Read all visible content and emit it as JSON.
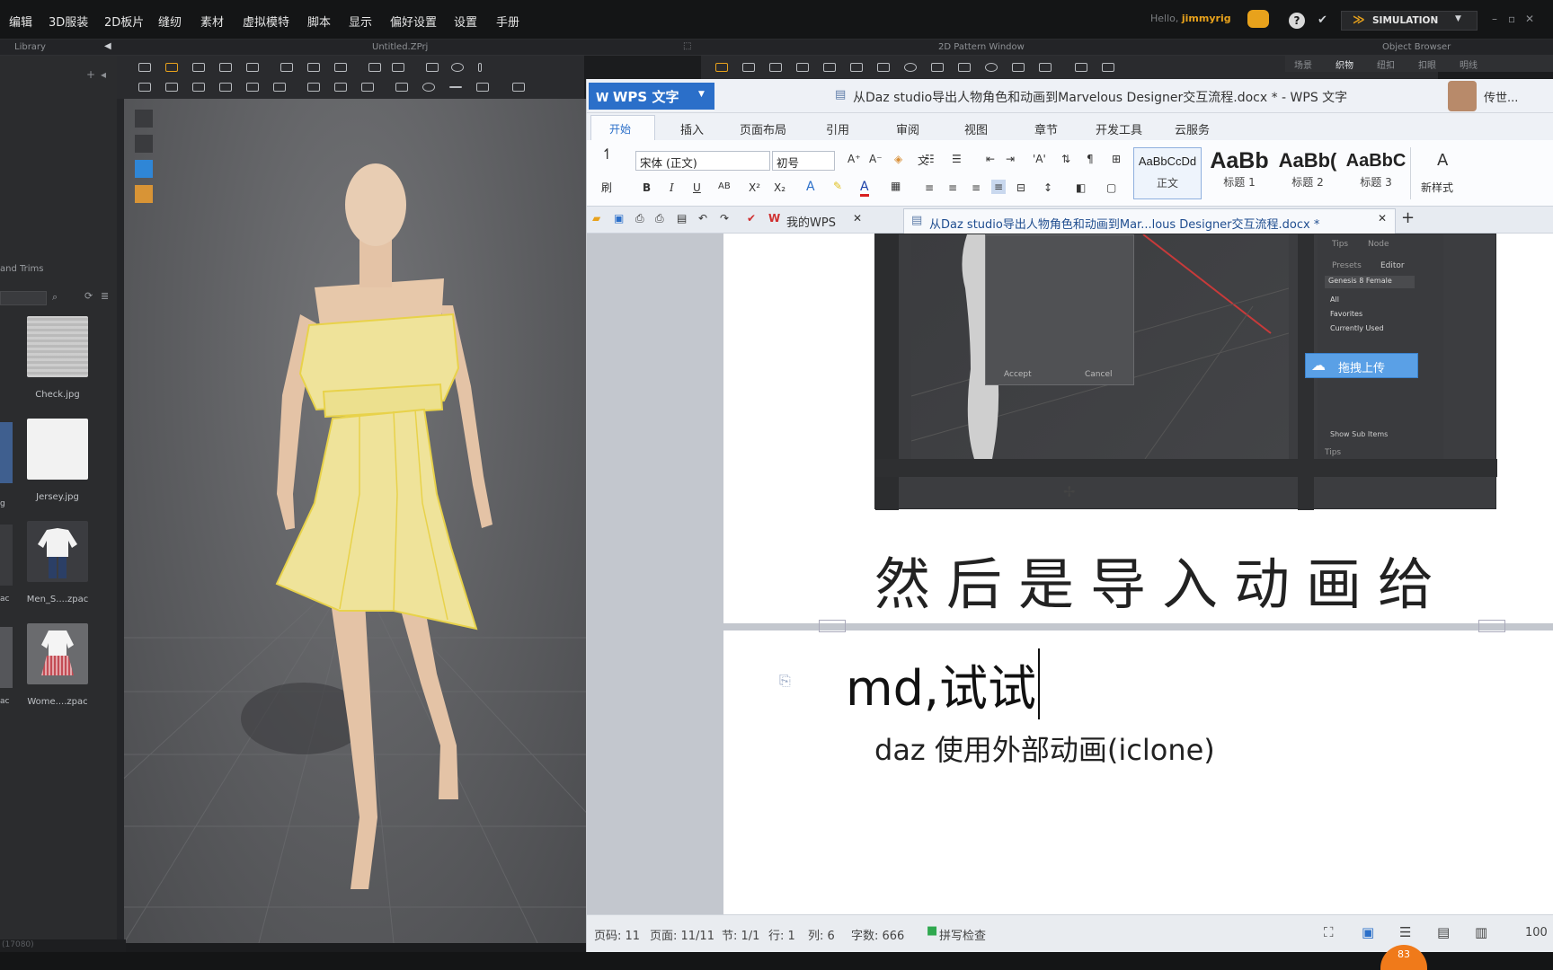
{
  "md": {
    "menu": [
      "编辑",
      "3D服装",
      "2D板片",
      "缝纫",
      "素材",
      "虚拟模特",
      "脚本",
      "显示",
      "偏好设置",
      "设置",
      "手册"
    ],
    "user_greeting": "Hello,",
    "user_name": "jimmyrig",
    "simulation_label": "SIMULATION",
    "library_title": "Library",
    "project_title": "Untitled.ZPrj",
    "pattern_window_title": "2D Pattern Window",
    "object_browser_title": "Object Browser",
    "object_browser_tabs": [
      "场景",
      "织物",
      "纽扣",
      "扣眼",
      "明线"
    ],
    "library_section_label": "and Trims",
    "library_items": [
      {
        "name": "Check.jpg",
        "icon": "check-fabric-thumb"
      },
      {
        "name": "Jersey.jpg",
        "icon": "jersey-fabric-thumb"
      },
      {
        "name": "Men_S....zpac",
        "icon": "men-shirt-thumb"
      },
      {
        "name": "Wome....zpac",
        "icon": "women-dress-thumb"
      }
    ],
    "left_cut_labels": [
      "g",
      "ac",
      "ac"
    ],
    "status_text": "(17080)"
  },
  "wps": {
    "app_name": "WPS 文字",
    "doc_title": "从Daz studio导出人物角色和动画到Marvelous Designer交互流程.docx * - WPS 文字",
    "account_label": "传世...",
    "ribbon_tabs": [
      "开始",
      "插入",
      "页面布局",
      "引用",
      "审阅",
      "视图",
      "章节",
      "开发工具",
      "云服务"
    ],
    "clipboard_label": "刷",
    "font_name": "宋体 (正文)",
    "font_size": "初号",
    "styles": [
      {
        "sample": "AaBbCcDd",
        "name": "正文"
      },
      {
        "sample": "AaBb",
        "name": "标题 1"
      },
      {
        "sample": "AaBb(",
        "name": "标题 2"
      },
      {
        "sample": "AaBbC",
        "name": "标题 3"
      }
    ],
    "new_style_label": "新样式",
    "my_wps_tab": "我的WPS",
    "doc_tab": "从Daz studio导出人物角色和动画到Mar...lous Designer交互流程.docx *",
    "embedded_screenshot": {
      "accept": "Accept",
      "cancel": "Cancel",
      "right_tabs": [
        "Tips",
        "Node"
      ],
      "sub_tabs": [
        "Presets",
        "Editor"
      ],
      "dropdown": "Genesis 8 Female",
      "list_items": [
        "All",
        "Favorites",
        "Currently Used"
      ],
      "upload_label": "拖拽上传",
      "show_sub": "Show Sub Items",
      "tips_label": "Tips"
    },
    "heading_text": "然后是导入动画给",
    "line1_text": "md,试试",
    "line2_text": "daz 使用外部动画(iclone)",
    "status": {
      "page_no": "页码: 11",
      "pages": "页面: 11/11",
      "section": "节: 1/1",
      "row": "行: 1",
      "col": "列: 6",
      "words": "字数: 666",
      "spell": "拼写检查",
      "zoom": "100"
    },
    "badge": "83"
  },
  "colors": {
    "wps_blue": "#2b6fc9",
    "md_accent": "#e8a21c",
    "garment_yellow": "#efe39a"
  }
}
